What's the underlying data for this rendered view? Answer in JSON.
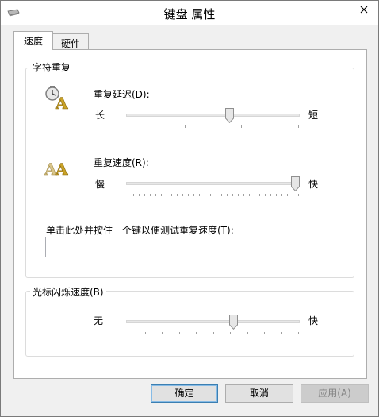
{
  "window": {
    "title": "键盘 属性"
  },
  "tabs": [
    {
      "label": "速度",
      "active": true
    },
    {
      "label": "硬件",
      "active": false
    }
  ],
  "repeat_group": {
    "title": "字符重复",
    "delay": {
      "label": "重复延迟(D):",
      "min_label": "长",
      "max_label": "短",
      "level": 0.6,
      "tick_count": 4
    },
    "rate": {
      "label": "重复速度(R):",
      "min_label": "慢",
      "max_label": "快",
      "level": 1.0,
      "tick_count": 32
    },
    "test": {
      "label": "单击此处并按住一个键以便测试重复速度(T):",
      "value": ""
    }
  },
  "cursor_group": {
    "title": "光标闪烁速度(B)",
    "blink": {
      "min_label": "无",
      "max_label": "快",
      "level": 0.625,
      "tick_count": 11
    }
  },
  "buttons": {
    "ok": "确定",
    "cancel": "取消",
    "apply": "应用(A)"
  },
  "colors": {
    "accent_blue": "#3c7fb1",
    "slider_gold": "#c9a227"
  }
}
